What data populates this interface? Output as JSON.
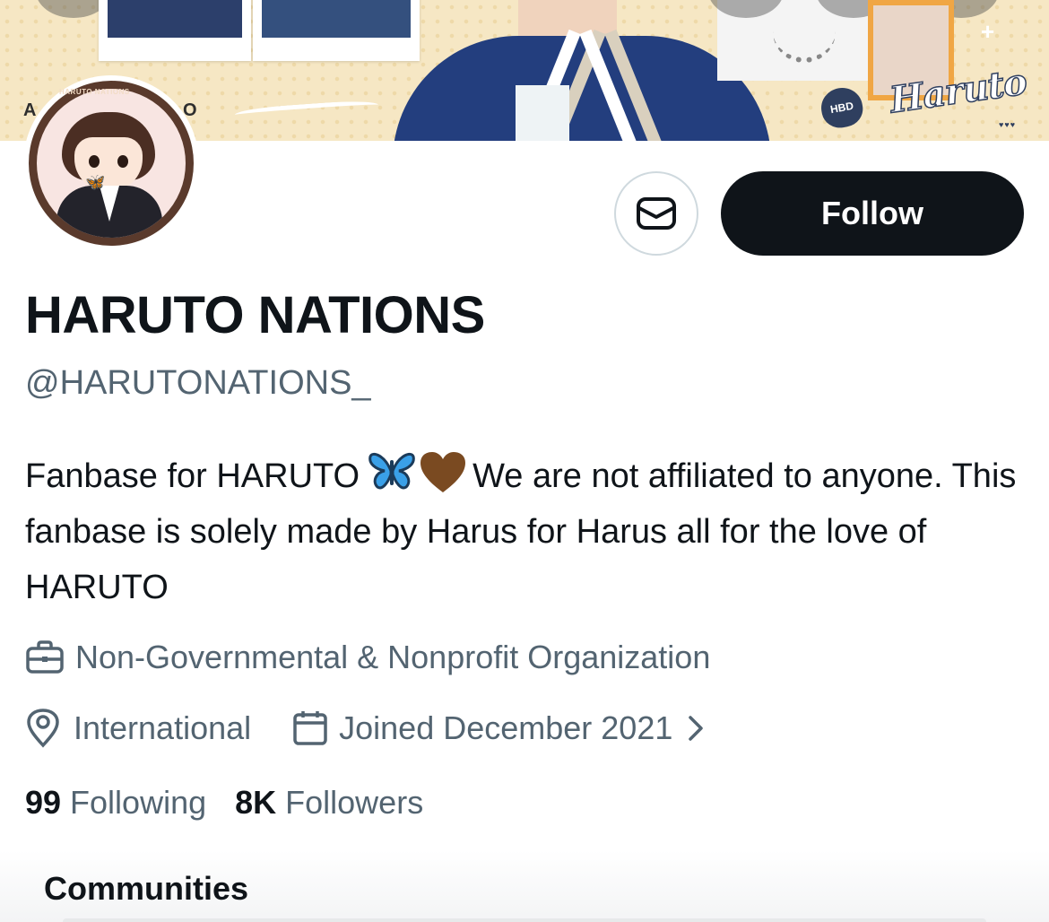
{
  "banner": {
    "left_text": "A",
    "mid_text": "O",
    "hbd_text": "HBD",
    "script_text": "Haruto"
  },
  "avatar": {
    "ring_text": "HARUTO NATIONS"
  },
  "profile": {
    "display_name": "HARUTO NATIONS",
    "handle": "@HARUTONATIONS_",
    "bio_part1": "Fanbase for HARUTO",
    "bio_part2": "We are not affiliated to anyone. This fanbase is solely made by Harus for Harus all for the love of HARUTO",
    "category": "Non-Governmental & Nonprofit Organization",
    "location": "International",
    "joined": "Joined December 2021"
  },
  "actions": {
    "follow_label": "Follow"
  },
  "stats": {
    "following_count": "99",
    "following_label": "Following",
    "followers_count": "8K",
    "followers_label": "Followers"
  },
  "communities": {
    "title": "Communities"
  },
  "colors": {
    "text_primary": "#0f1419",
    "text_secondary": "#536471",
    "follow_bg": "#0f1419",
    "border": "#cfd9de",
    "butterfly": "#3aa0e8",
    "brown_heart": "#7a4a21"
  },
  "icons": {
    "message": "envelope-icon",
    "category": "briefcase-icon",
    "location": "location-pin-icon",
    "joined": "calendar-icon",
    "joined_more": "chevron-right-icon"
  }
}
